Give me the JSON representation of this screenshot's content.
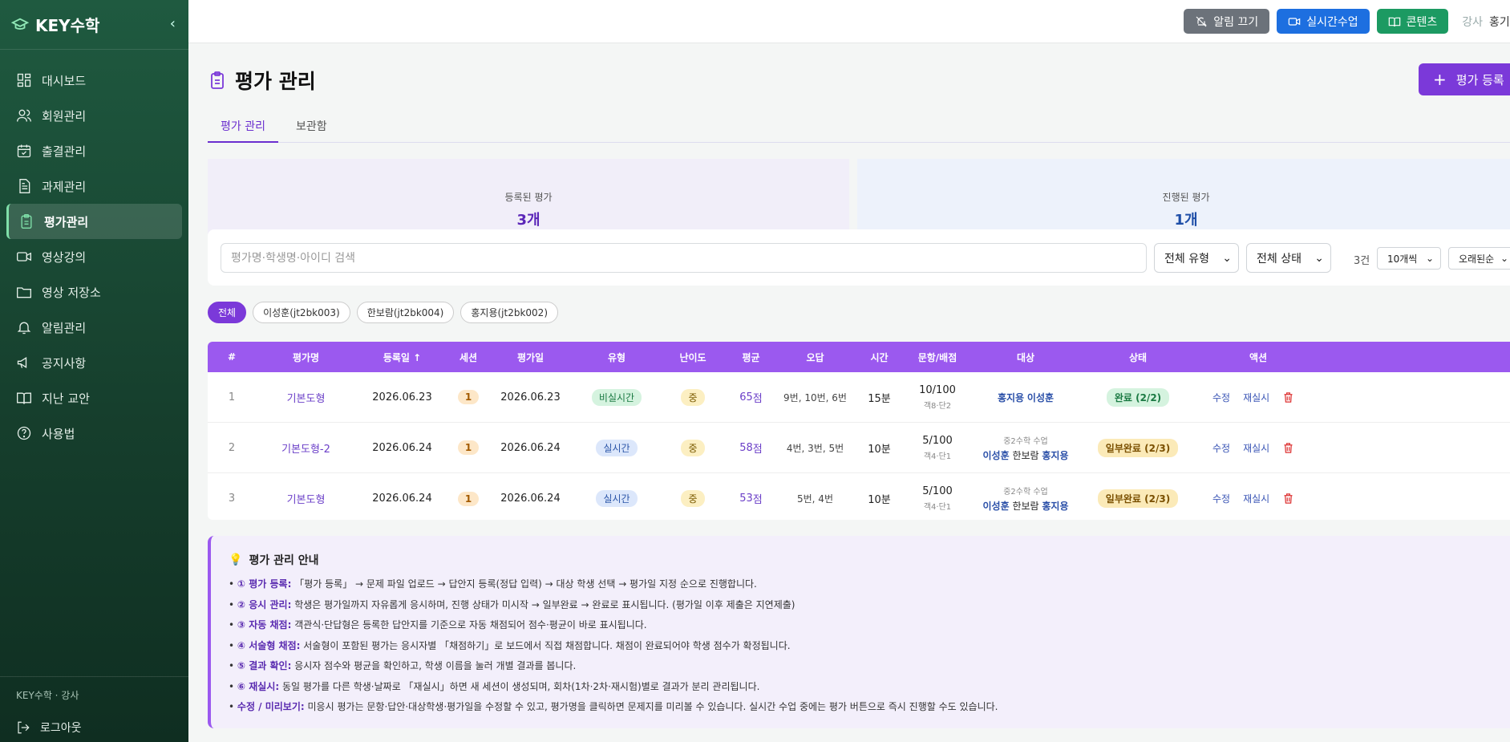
{
  "brand": {
    "name": "KEY수학",
    "collapse_icon": "chevron-left-icon"
  },
  "sidebar": {
    "items": [
      {
        "label": "대시보드",
        "icon": "dashboard-icon"
      },
      {
        "label": "회원관리",
        "icon": "users-icon"
      },
      {
        "label": "출결관리",
        "icon": "calendar-icon"
      },
      {
        "label": "과제관리",
        "icon": "file-icon"
      },
      {
        "label": "평가관리",
        "icon": "clipboard-icon",
        "active": true
      },
      {
        "label": "영상강의",
        "icon": "video-icon"
      },
      {
        "label": "영상 저장소",
        "icon": "folder-icon"
      },
      {
        "label": "알림관리",
        "icon": "bell-icon"
      },
      {
        "label": "공지사항",
        "icon": "megaphone-icon"
      },
      {
        "label": "지난 교안",
        "icon": "book-icon"
      },
      {
        "label": "사용법",
        "icon": "help-icon"
      }
    ],
    "role": "KEY수학 · 강사",
    "logout": "로그아웃"
  },
  "topbar": {
    "mute": "알림 끄기",
    "live": "실시간수업",
    "content": "콘텐츠",
    "role": "강사",
    "user": "홍기"
  },
  "page": {
    "title": "평가 관리",
    "add_button": "평가 등록"
  },
  "tabs": [
    {
      "label": "평가 관리",
      "active": true
    },
    {
      "label": "보관함"
    }
  ],
  "stats": [
    {
      "label": "등록된 평가",
      "value": "3개"
    },
    {
      "label": "진행된 평가",
      "value": "1개"
    }
  ],
  "filters": {
    "search_placeholder": "평가명·학생명·아이디 검색",
    "type": "전체 유형",
    "status": "전체 상태",
    "count": "3건",
    "page_size": "10개씩",
    "sort": "오래된순"
  },
  "chips": [
    "전체",
    "이성훈(jt2bk003)",
    "한보람(jt2bk004)",
    "홍지용(jt2bk002)"
  ],
  "table": {
    "headers": [
      "#",
      "평가명",
      "등록일 ↑",
      "세션",
      "평가일",
      "유형",
      "난이도",
      "평균",
      "오답",
      "시간",
      "문항/배점",
      "대상",
      "상태",
      "액션"
    ],
    "rows": [
      {
        "no": "1",
        "name": "기본도형",
        "reg": "2026.06.23",
        "session": "1",
        "date": "2026.06.23",
        "type": "비실시간",
        "type_color": "green",
        "level": "중",
        "avg": "65",
        "avg_unit": "점",
        "wrong": "9번, 10번, 6번",
        "time": "15분",
        "score": "10/100",
        "score_sub": "객8·단2",
        "target_class": "",
        "target_a": "홍지용",
        "target_b": "",
        "target_c": "이성훈",
        "status": "완료 (2/2)",
        "status_kind": "done",
        "edit": "수정",
        "retest": "재실시"
      },
      {
        "no": "2",
        "name": "기본도형-2",
        "reg": "2026.06.24",
        "session": "1",
        "date": "2026.06.24",
        "type": "실시간",
        "type_color": "blue",
        "level": "중",
        "avg": "58",
        "avg_unit": "점",
        "wrong": "4번, 3번, 5번",
        "time": "10분",
        "score": "5/100",
        "score_sub": "객4·단1",
        "target_class": "중2수학 수업",
        "target_a": "이성훈",
        "target_b": "한보람",
        "target_c": "홍지용",
        "status": "일부완료 (2/3)",
        "status_kind": "partial",
        "edit": "수정",
        "retest": "재실시"
      },
      {
        "no": "3",
        "name": "기본도형",
        "reg": "2026.06.24",
        "session": "1",
        "date": "2026.06.24",
        "type": "실시간",
        "type_color": "blue",
        "level": "중",
        "avg": "53",
        "avg_unit": "점",
        "wrong": "5번, 4번",
        "time": "10분",
        "score": "5/100",
        "score_sub": "객4·단1",
        "target_class": "중2수학 수업",
        "target_a": "이성훈",
        "target_b": "한보람",
        "target_c": "홍지용",
        "status": "일부완료 (2/3)",
        "status_kind": "partial",
        "edit": "수정",
        "retest": "재실시"
      }
    ]
  },
  "guide": {
    "title": "평가 관리 안내",
    "items": [
      {
        "head": "① 평가 등록:",
        "text": "「평가 등록」 → 문제 파일 업로드 → 답안지 등록(정답 입력) → 대상 학생 선택 → 평가일 지정 순으로 진행합니다."
      },
      {
        "head": "② 응시 관리:",
        "text": "학생은 평가일까지 자유롭게 응시하며, 진행 상태가 미시작 → 일부완료 → 완료로 표시됩니다. (평가일 이후 제출은 지연제출)"
      },
      {
        "head": "③ 자동 채점:",
        "text": "객관식·단답형은 등록한 답안지를 기준으로 자동 채점되어 점수·평균이 바로 표시됩니다."
      },
      {
        "head": "④ 서술형 채점:",
        "text": "서술형이 포함된 평가는 응시자별 「채점하기」로 보드에서 직접 채점합니다. 채점이 완료되어야 학생 점수가 확정됩니다."
      },
      {
        "head": "⑤ 결과 확인:",
        "text": "응시자 점수와 평균을 확인하고, 학생 이름을 눌러 개별 결과를 봅니다."
      },
      {
        "head": "⑥ 재실시:",
        "text": "동일 평가를 다른 학생·날짜로 「재실시」하면 새 세션이 생성되며, 회차(1차·2차·재시험)별로 결과가 분리 관리됩니다."
      },
      {
        "head": "수정 / 미리보기:",
        "text": "미응시 평가는 문항·답안·대상학생·평가일을 수정할 수 있고, 평가명을 클릭하면 문제지를 미리볼 수 있습니다. 실시간 수업 중에는 평가 버튼으로 즉시 진행할 수도 있습니다."
      }
    ]
  }
}
